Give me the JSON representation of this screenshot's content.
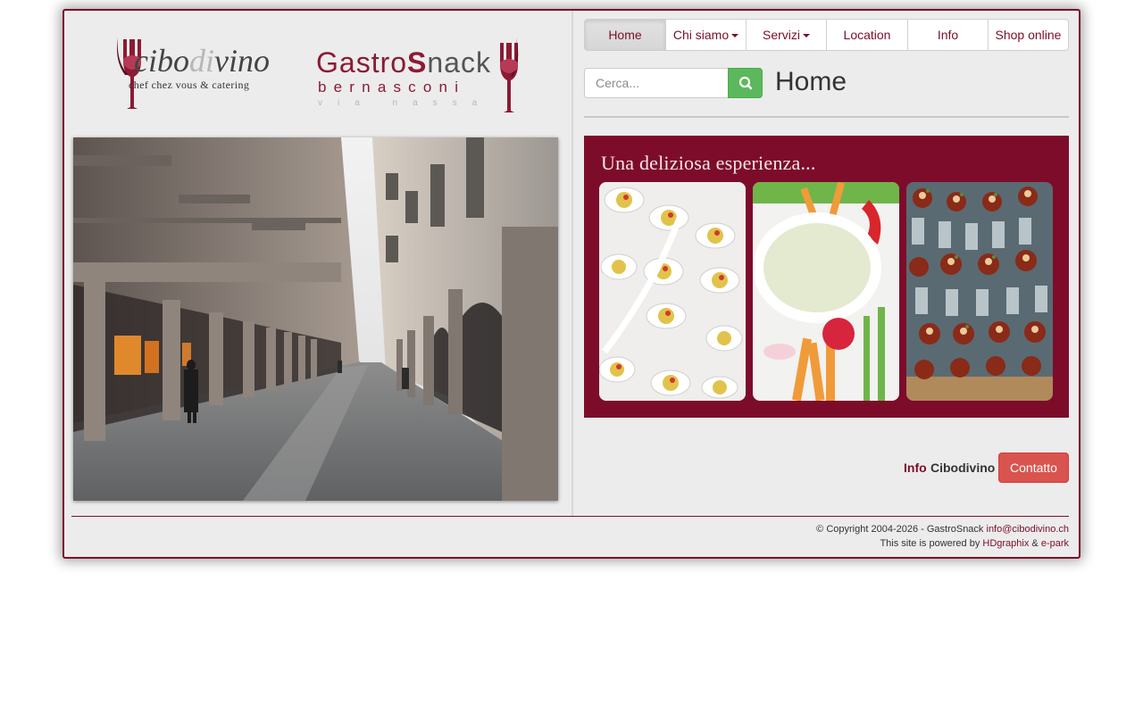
{
  "logos": {
    "cibodivino": {
      "name_part1": "cibo",
      "name_part2": "di",
      "name_part3": "vino",
      "tagline": "chef chez vous & catering"
    },
    "gastrosnack": {
      "name_part1": "Gastro",
      "name_part2": "S",
      "name_part3": "nack",
      "subtitle": "bernasconi",
      "small_line": "via nassa"
    }
  },
  "nav": {
    "items": [
      {
        "label": "Home",
        "active": true,
        "dropdown": false
      },
      {
        "label": "Chi siamo",
        "active": false,
        "dropdown": true
      },
      {
        "label": "Servizi",
        "active": false,
        "dropdown": true
      },
      {
        "label": "Location",
        "active": false,
        "dropdown": false
      },
      {
        "label": "Info",
        "active": false,
        "dropdown": false
      },
      {
        "label": "Shop online",
        "active": false,
        "dropdown": false
      }
    ]
  },
  "search": {
    "placeholder": "Cerca...",
    "button_icon": "search-icon"
  },
  "page": {
    "title": "Home"
  },
  "banner": {
    "caption": "Una deliziosa esperienza..."
  },
  "contact": {
    "info_label": "Info",
    "info_name": "Cibodivino",
    "button_label": "Contatto"
  },
  "footer": {
    "copyright": "© Copyright 2004-2026 - GastroSnack ",
    "email": "info@cibodivino.ch",
    "powered_prefix": "This site is powered by ",
    "powered_link1": "HDgraphix",
    "powered_and": " & ",
    "powered_link2": "e-park"
  },
  "colors": {
    "brand": "#7a0e2a",
    "banner_bg": "#7d0c2a",
    "search_button": "#5cb85c",
    "contact_button": "#d9534f"
  }
}
